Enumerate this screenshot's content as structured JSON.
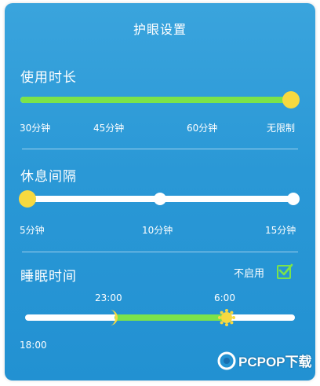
{
  "header": {
    "title": "护眼设置"
  },
  "usage_duration": {
    "label": "使用时长",
    "options": [
      "30分钟",
      "45分钟",
      "60分钟",
      "无限制"
    ],
    "selected": "无限制"
  },
  "rest_interval": {
    "label": "休息间隔",
    "options": [
      "5分钟",
      "10分钟",
      "15分钟"
    ],
    "selected": "5分钟"
  },
  "sleep_time": {
    "label": "睡眠时间",
    "disable_label": "不启用",
    "disable_checked": true,
    "start": "23:00",
    "end": "6:00",
    "range_start": "18:00"
  },
  "watermark": {
    "text": "PCPOP下载"
  },
  "colors": {
    "panel": "#2a98d6",
    "fill": "#7be34a",
    "knob": "#f7d940",
    "text": "#ffffff"
  },
  "icons": {
    "sleep_start": "moon-icon",
    "sleep_end": "sun-icon",
    "checkbox": "checkmark-icon"
  }
}
